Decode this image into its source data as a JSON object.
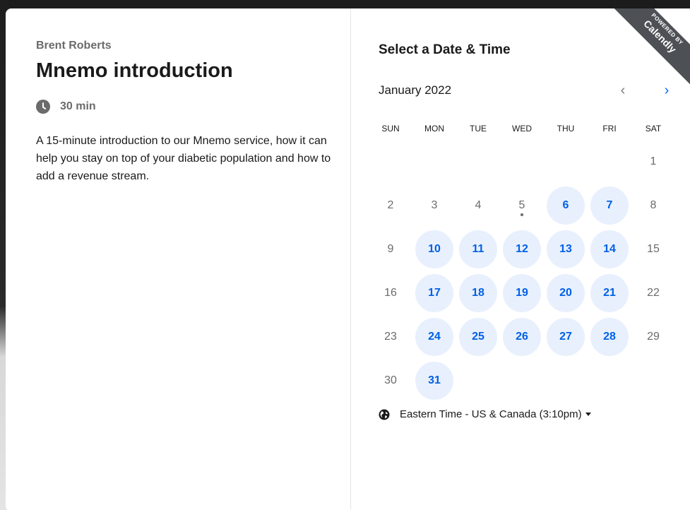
{
  "event": {
    "host": "Brent Roberts",
    "title": "Mnemo introduction",
    "duration": "30 min",
    "description": "A 15-minute introduction to our Mnemo service, how it can help you stay on top of your diabetic population and how to add a revenue stream."
  },
  "scheduler": {
    "title": "Select a Date & Time",
    "month": "January 2022",
    "prev_icon": "‹",
    "next_icon": "›",
    "weekdays": [
      "SUN",
      "MON",
      "TUE",
      "WED",
      "THU",
      "FRI",
      "SAT"
    ],
    "weeks": [
      [
        null,
        null,
        null,
        null,
        null,
        null,
        {
          "d": "1",
          "available": false
        }
      ],
      [
        {
          "d": "2",
          "available": false
        },
        {
          "d": "3",
          "available": false
        },
        {
          "d": "4",
          "available": false
        },
        {
          "d": "5",
          "available": false,
          "today": true
        },
        {
          "d": "6",
          "available": true
        },
        {
          "d": "7",
          "available": true
        },
        {
          "d": "8",
          "available": false
        }
      ],
      [
        {
          "d": "9",
          "available": false
        },
        {
          "d": "10",
          "available": true
        },
        {
          "d": "11",
          "available": true
        },
        {
          "d": "12",
          "available": true
        },
        {
          "d": "13",
          "available": true
        },
        {
          "d": "14",
          "available": true
        },
        {
          "d": "15",
          "available": false
        }
      ],
      [
        {
          "d": "16",
          "available": false
        },
        {
          "d": "17",
          "available": true
        },
        {
          "d": "18",
          "available": true
        },
        {
          "d": "19",
          "available": true
        },
        {
          "d": "20",
          "available": true
        },
        {
          "d": "21",
          "available": true
        },
        {
          "d": "22",
          "available": false
        }
      ],
      [
        {
          "d": "23",
          "available": false
        },
        {
          "d": "24",
          "available": true
        },
        {
          "d": "25",
          "available": true
        },
        {
          "d": "26",
          "available": true
        },
        {
          "d": "27",
          "available": true
        },
        {
          "d": "28",
          "available": true
        },
        {
          "d": "29",
          "available": false
        }
      ],
      [
        {
          "d": "30",
          "available": false
        },
        {
          "d": "31",
          "available": true
        },
        null,
        null,
        null,
        null,
        null
      ]
    ],
    "timezone": "Eastern Time - US & Canada (3:10pm)"
  },
  "ribbon": {
    "small_text": "POWERED BY",
    "brand": "Calendly"
  },
  "colors": {
    "accent": "#0069ff",
    "available_bg": "#e8f0fd",
    "ribbon_bg": "#4d5055"
  },
  "icons": {
    "duration": "clock-icon",
    "timezone": "globe-icon",
    "timezone_toggle": "caret-down-icon"
  }
}
